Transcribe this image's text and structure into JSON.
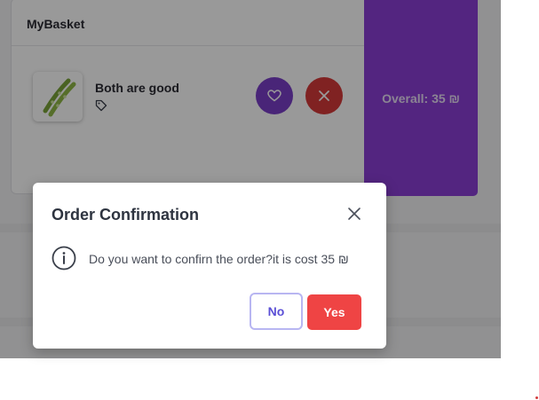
{
  "basket": {
    "title": "MyBasket",
    "item": {
      "name": "Both are good",
      "thumbnail_icon": "green-bean-pods-icon",
      "tag_icon": "tag-icon"
    },
    "actions": {
      "favorite_icon": "heart-icon",
      "remove_icon": "close-icon"
    },
    "overall": "Overall: 35 ₪"
  },
  "dialog": {
    "title": "Order Confirmation",
    "close_icon": "close-icon",
    "info_icon": "info-circle-icon",
    "message": "Do you want to confirn the order?it is cost 35 ₪",
    "no_label": "No",
    "yes_label": "Yes"
  },
  "colors": {
    "accent_purple": "#8a3fd6",
    "favorite_button": "#7b3fc8",
    "remove_button": "#d63a3a",
    "yes_button": "#ef4444",
    "no_button_border": "#b8b6f2"
  }
}
